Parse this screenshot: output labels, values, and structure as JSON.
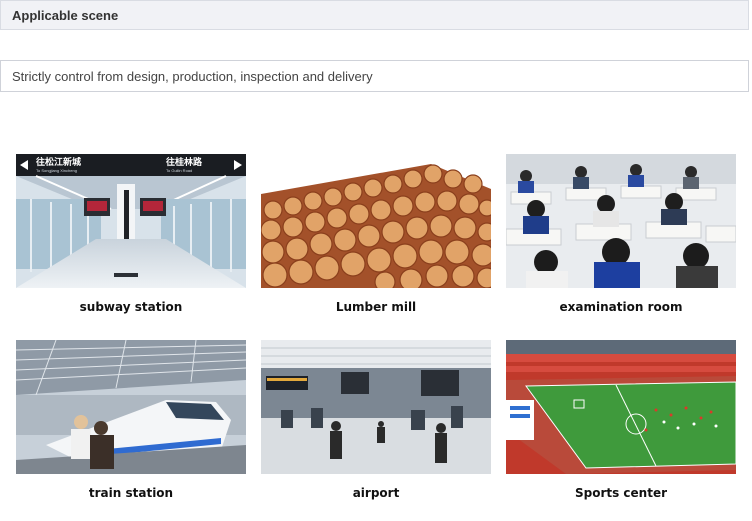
{
  "header": {
    "title": "Applicable scene"
  },
  "description": "Strictly control from design, production, inspection and delivery",
  "scenes": [
    {
      "caption": "subway station",
      "image": "subway-station-photo",
      "sign_left": "往松江新城",
      "sign_left_sub": "To Songjiang Xincheng",
      "sign_right": "往桂林路",
      "sign_right_sub": "To Guilin Road"
    },
    {
      "caption": "Lumber mill",
      "image": "lumber-logs-photo"
    },
    {
      "caption": "examination room",
      "image": "exam-room-photo"
    },
    {
      "caption": "train station",
      "image": "train-station-photo"
    },
    {
      "caption": "airport",
      "image": "airport-photo"
    },
    {
      "caption": "Sports center",
      "image": "stadium-photo"
    }
  ]
}
